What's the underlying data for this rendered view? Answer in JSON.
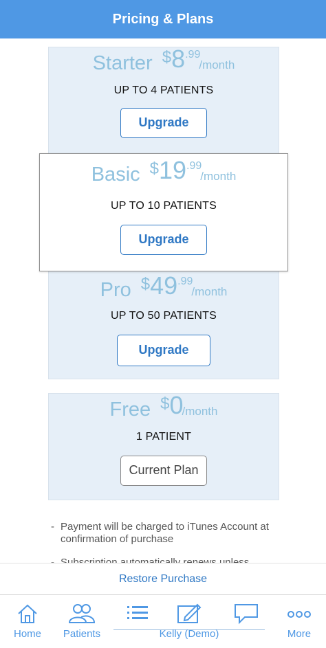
{
  "header": {
    "title": "Pricing & Plans"
  },
  "plans": [
    {
      "name": "Starter",
      "currency": "$",
      "amount": "8",
      "cents": ".99",
      "period": "/month",
      "patients": "UP TO 4 PATIENTS",
      "button": "Upgrade"
    },
    {
      "name": "Basic",
      "currency": "$",
      "amount": "19",
      "cents": ".99",
      "period": "/month",
      "patients": "UP TO 10 PATIENTS",
      "button": "Upgrade"
    },
    {
      "name": "Pro",
      "currency": "$",
      "amount": "49",
      "cents": ".99",
      "period": "/month",
      "patients": "UP TO 50 PATIENTS",
      "button": "Upgrade"
    },
    {
      "name": "Free",
      "currency": "$",
      "amount": "0",
      "cents": "",
      "period": "/month",
      "patients": "1 PATIENT",
      "button": "Current Plan"
    }
  ],
  "notes": [
    "Payment will be charged to iTunes Account at confirmation of purchase",
    "Subscription automatically renews unless"
  ],
  "restore": {
    "label": "Restore Purchase"
  },
  "tabbar": {
    "home": "Home",
    "patients": "Patients",
    "kelly": "Kelly (Demo)",
    "more": "More"
  },
  "colors": {
    "header": "#4f98e4",
    "accent": "#2f78c4",
    "plan_bg": "#e6eff8",
    "price": "#8fc1de"
  },
  "icons": [
    "home-icon",
    "patients-icon",
    "list-icon",
    "edit-icon",
    "chat-icon",
    "more-icon"
  ]
}
